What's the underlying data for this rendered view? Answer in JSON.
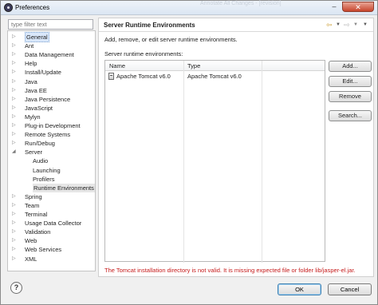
{
  "window": {
    "title": "Preferences",
    "ghost_title": "Annotate All Changes - [revision]",
    "minimize_icon": "minimize-icon",
    "close_icon": "close-icon",
    "close_label": "✕"
  },
  "filter": {
    "placeholder": "type filter text",
    "value": "type filter text"
  },
  "tree": {
    "items": [
      {
        "label": "General",
        "expanded": false,
        "selected": true
      },
      {
        "label": "Ant"
      },
      {
        "label": "Data Management"
      },
      {
        "label": "Help"
      },
      {
        "label": "Install/Update"
      },
      {
        "label": "Java"
      },
      {
        "label": "Java EE"
      },
      {
        "label": "Java Persistence"
      },
      {
        "label": "JavaScript"
      },
      {
        "label": "Mylyn"
      },
      {
        "label": "Plug-in Development"
      },
      {
        "label": "Remote Systems"
      },
      {
        "label": "Run/Debug"
      },
      {
        "label": "Server",
        "expanded": true
      },
      {
        "label": "Audio",
        "child": true
      },
      {
        "label": "Launching",
        "child": true
      },
      {
        "label": "Profilers",
        "child": true
      },
      {
        "label": "Runtime Environments",
        "child": true,
        "active": true
      },
      {
        "label": "Spring"
      },
      {
        "label": "Team"
      },
      {
        "label": "Terminal"
      },
      {
        "label": "Usage Data Collector"
      },
      {
        "label": "Validation"
      },
      {
        "label": "Web"
      },
      {
        "label": "Web Services"
      },
      {
        "label": "XML"
      }
    ]
  },
  "page": {
    "title": "Server Runtime Environments",
    "description": "Add, remove, or edit server runtime environments.",
    "list_label": "Server runtime environments:",
    "columns": [
      "Name",
      "Type"
    ],
    "rows": [
      {
        "name": "Apache Tomcat v6.0",
        "type": "Apache Tomcat v6.0",
        "icon": "server-icon"
      }
    ],
    "buttons": {
      "add": "Add...",
      "edit": "Edit...",
      "remove": "Remove",
      "search": "Search..."
    },
    "error": "The Tomcat installation directory is not valid. It is missing expected file or folder lib/jasper-el.jar."
  },
  "footer": {
    "help_icon": "help-icon",
    "help_glyph": "?",
    "ok": "OK",
    "cancel": "Cancel"
  },
  "colors": {
    "error": "#c51a1a",
    "selection": "#d9e7fa",
    "title_bar": "#dbe6f3"
  }
}
